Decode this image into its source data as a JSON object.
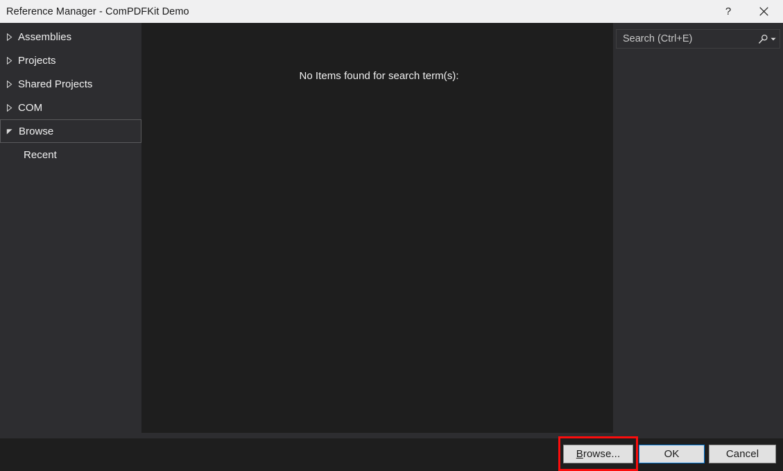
{
  "window": {
    "title": "Reference Manager - ComPDFKit Demo",
    "help_label": "?",
    "close_label": "✕"
  },
  "sidebar": {
    "items": [
      {
        "label": "Assemblies",
        "icon": "chevron-right-icon",
        "expanded": false,
        "selected": false,
        "child": false
      },
      {
        "label": "Projects",
        "icon": "chevron-right-icon",
        "expanded": false,
        "selected": false,
        "child": false
      },
      {
        "label": "Shared Projects",
        "icon": "chevron-right-icon",
        "expanded": false,
        "selected": false,
        "child": false
      },
      {
        "label": "COM",
        "icon": "chevron-right-icon",
        "expanded": false,
        "selected": false,
        "child": false
      },
      {
        "label": "Browse",
        "icon": "chevron-down-icon",
        "expanded": true,
        "selected": true,
        "child": false
      },
      {
        "label": "Recent",
        "icon": "none",
        "expanded": false,
        "selected": false,
        "child": true
      }
    ]
  },
  "search": {
    "value": "",
    "placeholder": "Search (Ctrl+E)",
    "icon": "search-icon",
    "dropdown_icon": "chevron-down-icon"
  },
  "main": {
    "empty_message": "No Items found for search term(s):"
  },
  "footer": {
    "browse_label_accel": "B",
    "browse_label_rest": "rowse...",
    "ok_label": "OK",
    "cancel_label": "Cancel"
  },
  "colors": {
    "titlebar_bg": "#f0f0f1",
    "panel_bg": "#2d2d30",
    "content_bg": "#1e1e1e",
    "text": "#f1f1f1",
    "button_bg": "#e1e1e1",
    "default_button_border": "#0078d7",
    "annotation": "#fb0d0d"
  }
}
